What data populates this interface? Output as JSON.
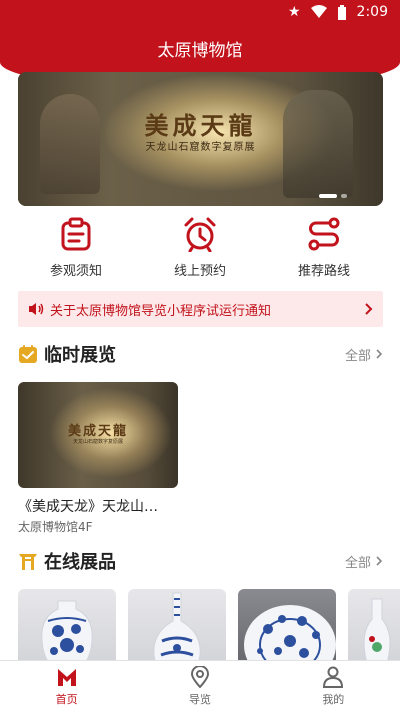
{
  "status_bar": {
    "time": "2:09",
    "icons": [
      "star-icon",
      "wifi-icon",
      "battery-icon"
    ]
  },
  "header": {
    "title": "太原博物馆"
  },
  "banner": {
    "calligraphy": "美成天龍",
    "subtitle": "天龙山石窟数字复原展",
    "slide_count": 2,
    "active_slide": 1
  },
  "quick_actions": [
    {
      "label": "参观须知",
      "icon": "clipboard-icon"
    },
    {
      "label": "线上预约",
      "icon": "alarm-clock-icon"
    },
    {
      "label": "推荐路线",
      "icon": "route-icon"
    }
  ],
  "notice": {
    "text": "关于太原博物馆导览小程序试运行通知",
    "icon": "speaker-icon"
  },
  "temp_exhibitions": {
    "title": "临时展览",
    "more_label": "全部",
    "items": [
      {
        "title": "《美成天龙》天龙山…",
        "location": "太原博物馆4F",
        "thumb_calligraphy": "美成天龍",
        "thumb_subtitle": "天龙山石窟数字复原展"
      }
    ]
  },
  "online_products": {
    "title": "在线展品",
    "more_label": "全部",
    "items": [
      {
        "name": "blue-white-vase-icon"
      },
      {
        "name": "blue-white-bottle-vase-icon"
      },
      {
        "name": "blue-white-plate-icon"
      },
      {
        "name": "porcelain-vase-icon"
      }
    ]
  },
  "tabbar": {
    "tabs": [
      {
        "label": "首页",
        "icon": "home-m-icon",
        "active": true
      },
      {
        "label": "导览",
        "icon": "location-pin-icon",
        "active": false
      },
      {
        "label": "我的",
        "icon": "user-icon",
        "active": false
      }
    ]
  },
  "colors": {
    "brand_red": "#c2121b",
    "notice_bg": "#fde9ea",
    "accent_gold": "#e5a823"
  }
}
